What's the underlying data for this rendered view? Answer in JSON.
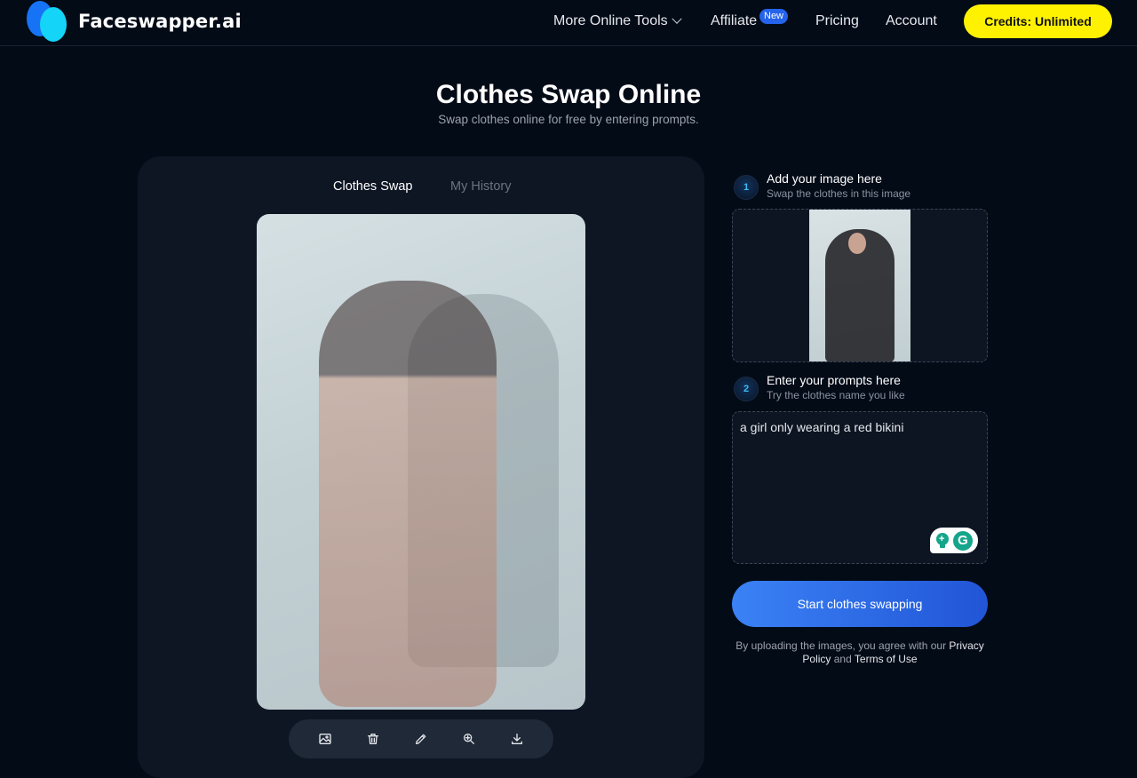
{
  "header": {
    "brand": "Faceswapper.ai",
    "nav": {
      "tools": "More Online Tools",
      "affiliate": "Affiliate",
      "affiliate_badge": "New",
      "pricing": "Pricing",
      "account": "Account"
    },
    "credits_button": "Credits: Unlimited"
  },
  "hero": {
    "title": "Clothes Swap Online",
    "subtitle": "Swap clothes online for free by entering prompts."
  },
  "editor": {
    "tabs": [
      {
        "label": "Clothes Swap",
        "active": true
      },
      {
        "label": "My History",
        "active": false
      }
    ],
    "preview_label": "Result image preview",
    "toolbar": [
      {
        "icon": "image-icon",
        "label": "Image"
      },
      {
        "icon": "trash-icon",
        "label": "Delete"
      },
      {
        "icon": "pencil-icon",
        "label": "Edit"
      },
      {
        "icon": "zoom-in-icon",
        "label": "Zoom"
      },
      {
        "icon": "download-icon",
        "label": "Download"
      }
    ]
  },
  "steps": [
    {
      "number": "1",
      "title": "Add your image here",
      "subtitle": "Swap the clothes in this image"
    },
    {
      "number": "2",
      "title": "Enter your prompts here",
      "subtitle": "Try the clothes name you like"
    }
  ],
  "prompt": {
    "value": "a girl only wearing a red bikini"
  },
  "start_button": "Start clothes swapping",
  "legal": {
    "prefix": "By uploading the images, you agree with our",
    "privacy": "Privacy Policy",
    "and": "and",
    "terms": "Terms of Use"
  },
  "colors": {
    "background": "#030b17",
    "card": "#0e1624",
    "credits": "#fff200",
    "accent": "#2563eb",
    "grammarly": "#15a58a"
  }
}
